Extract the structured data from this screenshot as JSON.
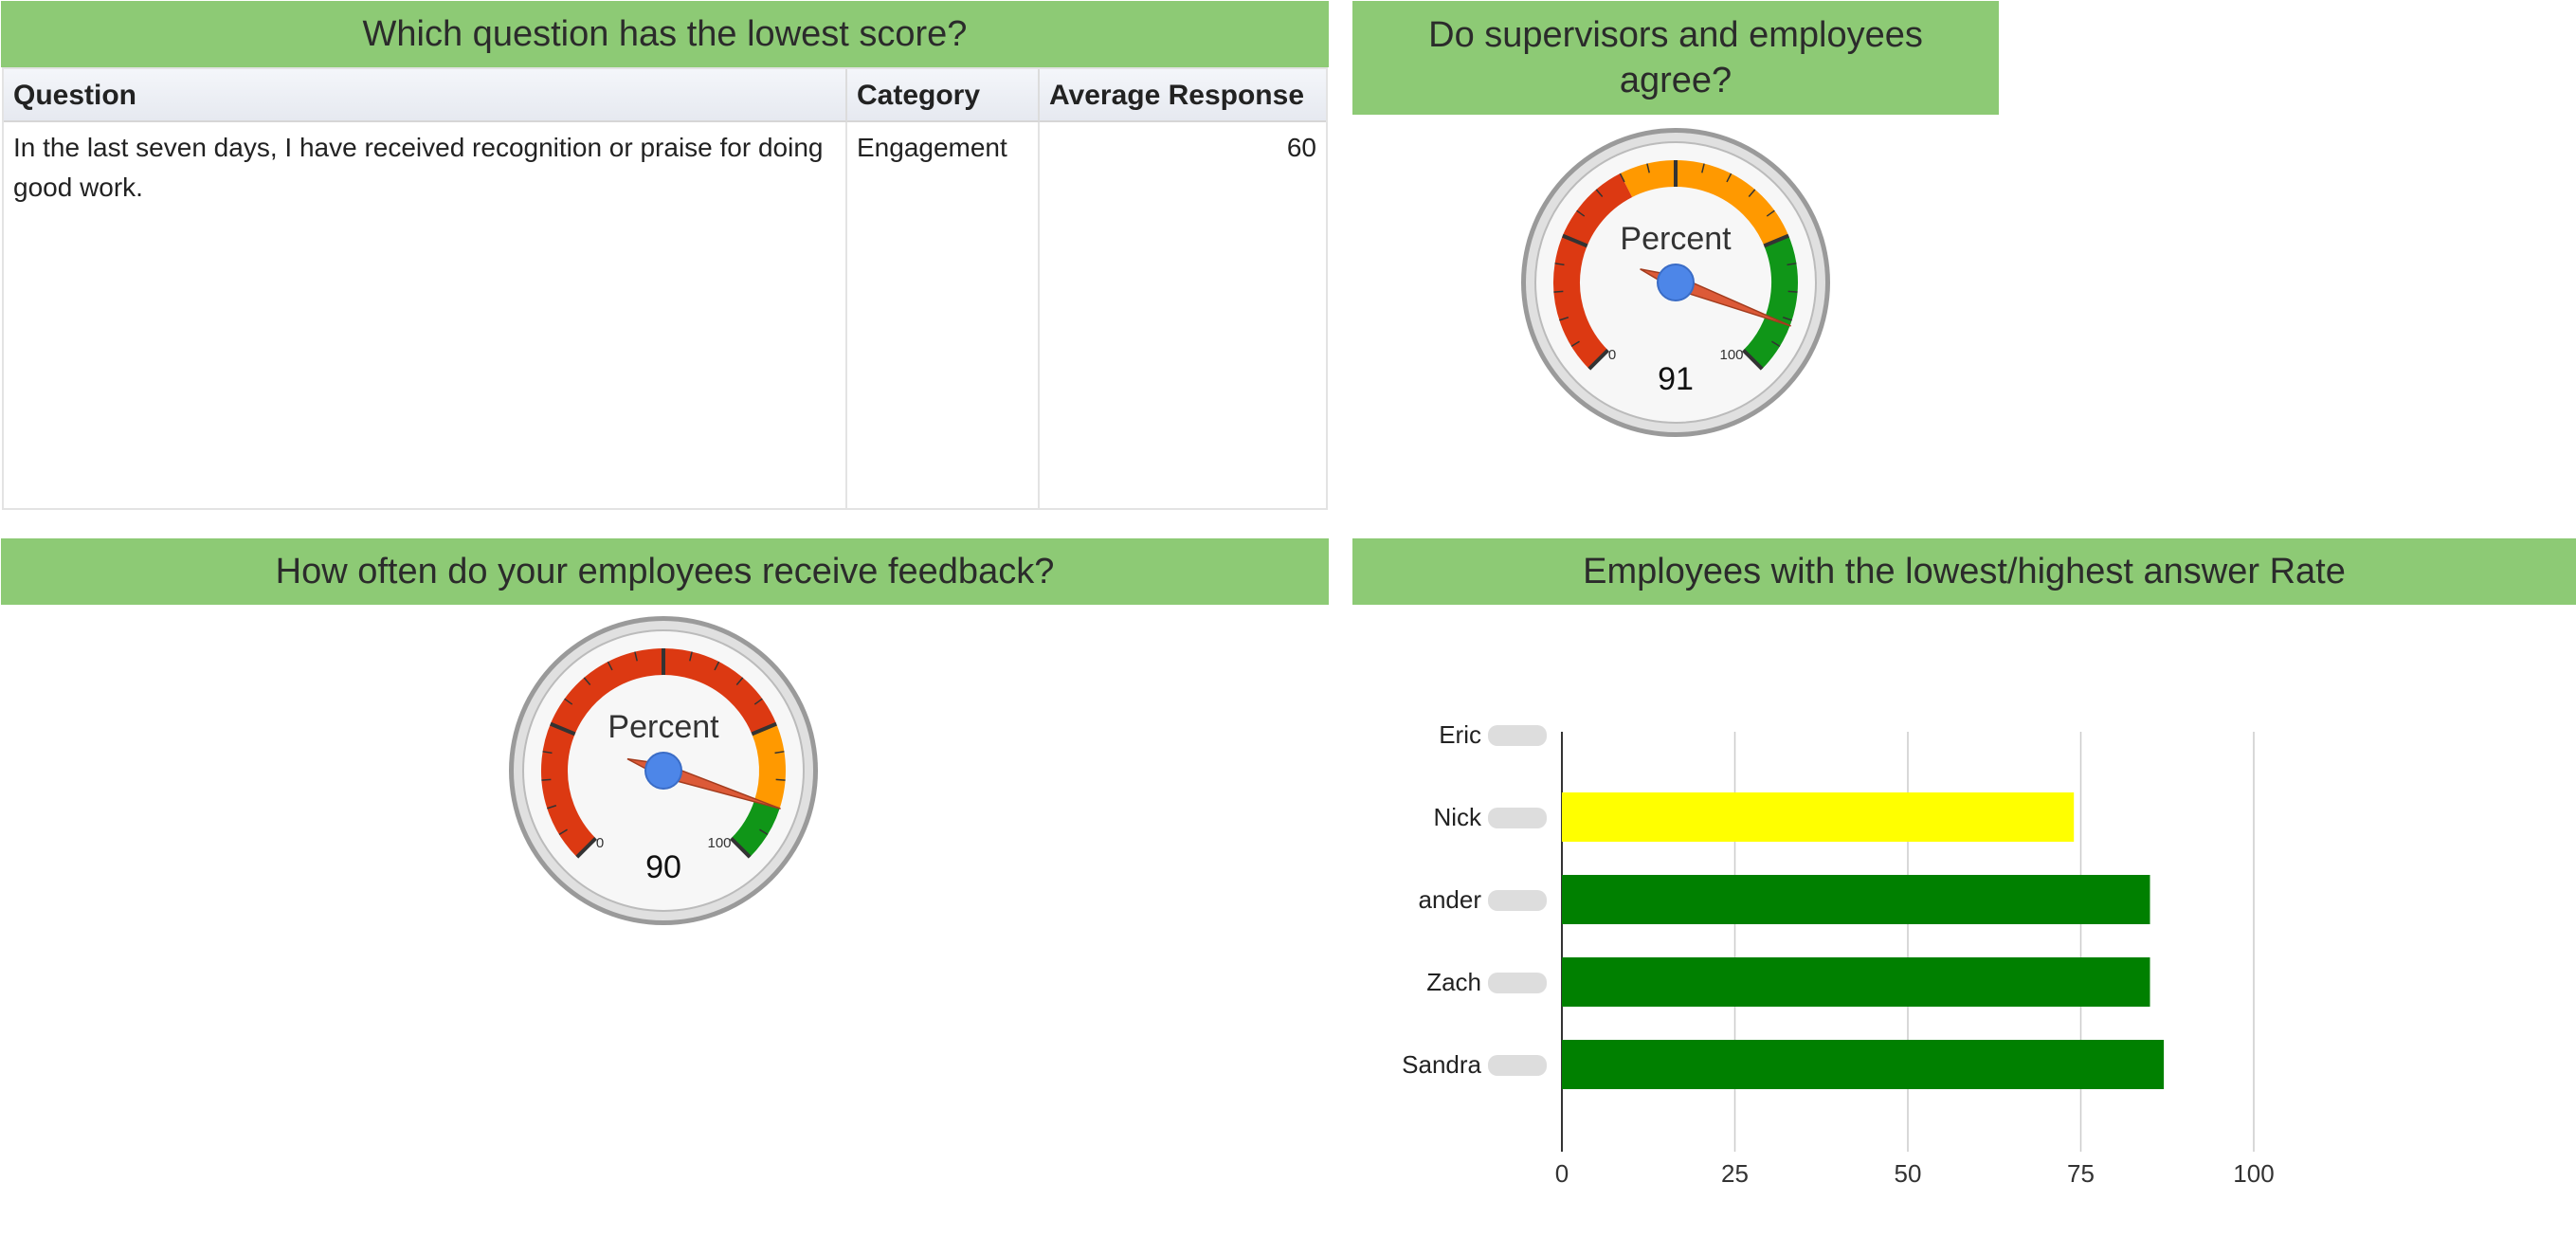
{
  "panels": {
    "lowest_score": {
      "title": "Which question has the lowest score?",
      "columns": [
        "Question",
        "Category",
        "Average Response"
      ],
      "rows": [
        {
          "question": "In the last seven days, I have received recognition or praise for doing good work.",
          "category": "Engagement",
          "average_response": "60"
        }
      ]
    },
    "supervisors_agree": {
      "title": "Do supervisors and employees agree?",
      "gauge": {
        "label": "Percent",
        "value": 91,
        "min_label": "0",
        "max_label": "100",
        "min": 0,
        "max": 100,
        "zones": [
          {
            "from": 0,
            "to": 40,
            "color": "#dc3912"
          },
          {
            "from": 40,
            "to": 75,
            "color": "#ff9900"
          },
          {
            "from": 75,
            "to": 100,
            "color": "#109618"
          }
        ]
      }
    },
    "feedback_frequency": {
      "title": "How often do your employees receive feedback?",
      "gauge": {
        "label": "Percent",
        "value": 90,
        "min_label": "0",
        "max_label": "100",
        "min": 0,
        "max": 100,
        "zones": [
          {
            "from": 0,
            "to": 75,
            "color": "#dc3912"
          },
          {
            "from": 75,
            "to": 90,
            "color": "#ff9900"
          },
          {
            "from": 90,
            "to": 100,
            "color": "#109618"
          }
        ]
      }
    },
    "answer_rate": {
      "title": "Employees with the lowest/highest answer Rate"
    }
  },
  "chart_data": {
    "type": "bar",
    "orientation": "horizontal",
    "categories": [
      "Eric",
      "Nick",
      "ander",
      "Zach",
      "Sandra"
    ],
    "values": [
      0,
      74,
      85,
      85,
      87
    ],
    "bar_colors": [
      "#008000",
      "#ffff00",
      "#008000",
      "#008000",
      "#008000"
    ],
    "xlim": [
      0,
      100
    ],
    "xticks": [
      "0",
      "25",
      "50",
      "75",
      "100"
    ],
    "grid": true,
    "legend": "none"
  }
}
